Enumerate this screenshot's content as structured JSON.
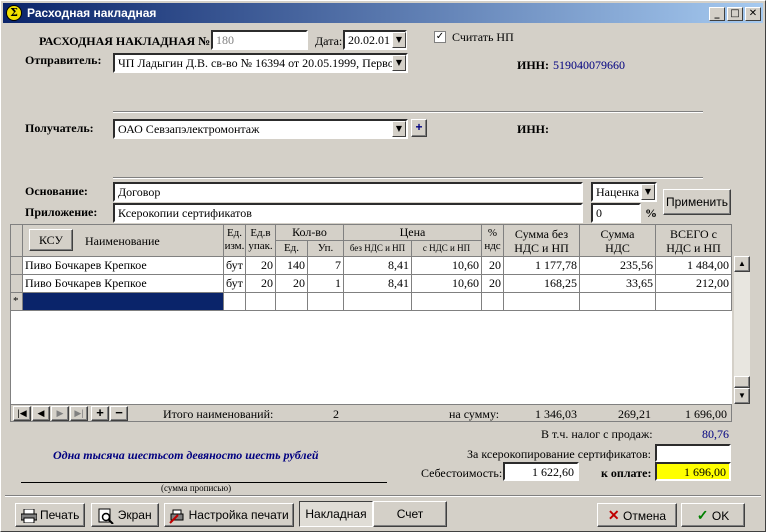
{
  "window": {
    "title": "Расходная накладная",
    "min_label": "_",
    "max_label": "□",
    "close_label": "✕"
  },
  "header": {
    "invoice_label": "РАСХОДНАЯ НАКЛАДНАЯ №",
    "invoice_number": "180",
    "date_label": "Дата:",
    "date_value": "20.02.01",
    "count_np_label": "Считать НП",
    "count_np_checked": true,
    "sender_label": "Отправитель:",
    "sender_value": "ЧП Ладыгин Д.В. св-во № 16394 от 20.05.1999, Перво",
    "inn_label": "ИНН:",
    "sender_inn": "519040079660",
    "receiver_label": "Получатель:",
    "receiver_value": "ОАО Севзапэлектромонтаж",
    "add_label": "+",
    "receiver_inn_label": "ИНН:",
    "basis_label": "Основание:",
    "basis_value": "Договор",
    "attachment_label": "Приложение:",
    "attachment_value": "Ксерокопии сертификатов",
    "markup_select": "Наценка",
    "markup_value": "0",
    "percent_label": "%",
    "apply_label": "Применить"
  },
  "grid": {
    "ksu_label": "КСУ",
    "headers": {
      "name": "Наименование",
      "unit": "Ед. изм.",
      "pack": "Ед.в упак.",
      "qty": "Кол-во",
      "qty_units": "Ед.",
      "qty_packs": "Уп.",
      "price": "Цена",
      "price_net": "без НДС и НП",
      "price_gross": "с НДС и НП",
      "vat_pct": "% ндс",
      "sum_net": "Сумма без НДС и НП",
      "sum_vat": "Сумма НДС",
      "total": "ВСЕГО с НДС и НП"
    },
    "rows": [
      {
        "name": "Пиво Бочкарев Крепкое",
        "unit": "бут",
        "pack": "20",
        "units": "140",
        "packs": "7",
        "price_net": "8,41",
        "price_gross": "10,60",
        "vat": "20",
        "sum_net": "1 177,78",
        "sum_vat": "235,56",
        "total": "1 484,00"
      },
      {
        "name": "Пиво Бочкарев Крепкое",
        "unit": "бут",
        "pack": "20",
        "units": "20",
        "packs": "1",
        "price_net": "8,41",
        "price_gross": "10,60",
        "vat": "20",
        "sum_net": "168,25",
        "sum_vat": "33,65",
        "total": "212,00"
      }
    ],
    "new_row_marker": "*"
  },
  "footer": {
    "items_label": "Итого наименований:",
    "items_count": "2",
    "sum_label": "на сумму:",
    "sum_net": "1 346,03",
    "sum_vat": "269,21",
    "sum_total": "1 696,00",
    "sales_tax_label": "В т.ч. налог с продаж:",
    "sales_tax_value": "80,76",
    "copy_label": "За ксерокопирование сертификатов:",
    "copy_value": "",
    "cost_label": "Себестоимость:",
    "cost_value": "1 622,60",
    "pay_label": "к оплате:",
    "pay_value": "1 696,00",
    "amount_words": "Одна тысяча шестьсот девяносто шесть рублей",
    "amount_words_caption": "(сумма прописью)"
  },
  "buttons": {
    "print": "Печать",
    "screen": "Экран",
    "print_settings": "Настройка печати",
    "invoice": "Накладная",
    "bill": "Счет",
    "cancel": "Отмена",
    "ok": "OK"
  },
  "colors": {
    "title_start": "#0a246a",
    "title_end": "#a6caf0",
    "pay_bg": "#ffff00",
    "link_blue": "#000080"
  }
}
